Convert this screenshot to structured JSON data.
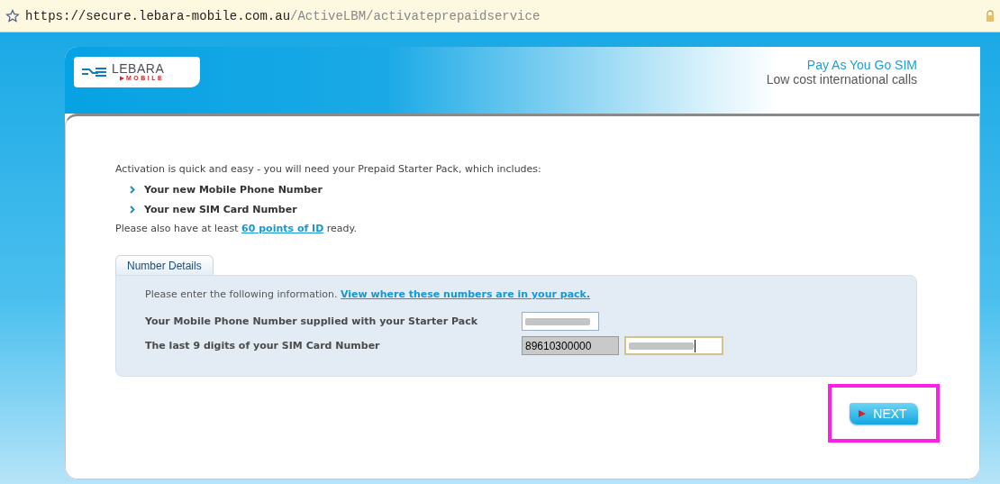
{
  "address_bar": {
    "url_host": "https://secure.lebara-mobile.com.au",
    "url_path": "/ActiveLBM/activateprepaidservice"
  },
  "header": {
    "logo_main": "LEBARA",
    "logo_sub": "MOBILE",
    "title": "Pay As You Go SIM",
    "subtitle": "Low cost international calls"
  },
  "intro": {
    "text": "Activation is quick and easy - you will need your Prepaid Starter Pack, which includes:",
    "items": [
      "Your new Mobile Phone Number",
      "Your new SIM Card Number"
    ],
    "note_before": "Please also have at least",
    "note_link": "60 points of ID",
    "note_after": "ready."
  },
  "panel": {
    "tab": "Number Details",
    "instruction": "Please enter the following information.",
    "instruction_link": "View where these numbers are in your pack.",
    "rows": [
      {
        "label": "Your Mobile Phone Number supplied with your Starter Pack",
        "fields": [
          {
            "kind": "redacted",
            "focused": false
          }
        ]
      },
      {
        "label": "The last 9 digits of your SIM Card Number",
        "fields": [
          {
            "kind": "readonly",
            "value": "89610300000",
            "focused": false
          },
          {
            "kind": "redacted",
            "focused": true
          }
        ]
      }
    ]
  },
  "next_button": {
    "label": "NEXT",
    "highlighted": true
  }
}
